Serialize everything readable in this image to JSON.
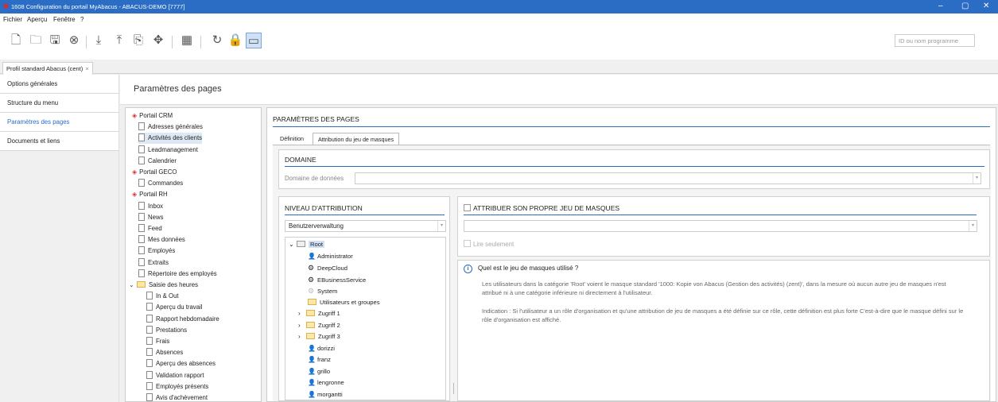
{
  "window": {
    "title": "1608 Configuration du portail MyAbacus - ABACUS-DEMO [7777]",
    "controls": [
      "–",
      "▢",
      "✕"
    ]
  },
  "menu": {
    "items": [
      "Fichier",
      "Aperçu",
      "Fenêtre",
      "?"
    ]
  },
  "toolbar": {
    "search_placeholder": "ID ou nom programme"
  },
  "doc_tab": {
    "label": "Profil standard Abacus (cent)",
    "close": "×"
  },
  "leftnav": {
    "items": [
      {
        "label": "Options générales",
        "selected": false
      },
      {
        "label": "Structure du menu",
        "selected": false
      },
      {
        "label": "Paramètres des pages",
        "selected": true
      },
      {
        "label": "Documents et liens",
        "selected": false
      }
    ]
  },
  "page": {
    "title": "Paramètres des pages"
  },
  "tree": {
    "rows": [
      {
        "label": "Portail CRM",
        "kind": "group",
        "level": 0
      },
      {
        "label": "Adresses générales",
        "kind": "page",
        "level": 1
      },
      {
        "label": "Activités des clients",
        "kind": "page",
        "level": 1,
        "selected": true
      },
      {
        "label": "Leadmanagement",
        "kind": "page",
        "level": 1
      },
      {
        "label": "Calendrier",
        "kind": "page",
        "level": 1
      },
      {
        "label": "Portail GECO",
        "kind": "group",
        "level": 0
      },
      {
        "label": "Commandes",
        "kind": "page",
        "level": 1
      },
      {
        "label": "Portail RH",
        "kind": "group",
        "level": 0
      },
      {
        "label": "Inbox",
        "kind": "page",
        "level": 1
      },
      {
        "label": "News",
        "kind": "page",
        "level": 1
      },
      {
        "label": "Feed",
        "kind": "page",
        "level": 1
      },
      {
        "label": "Mes données",
        "kind": "page",
        "level": 1
      },
      {
        "label": "Employés",
        "kind": "page",
        "level": 1
      },
      {
        "label": "Extraits",
        "kind": "page",
        "level": 1
      },
      {
        "label": "Répertoire des employés",
        "kind": "page",
        "level": 1
      },
      {
        "label": "Saisie des heures",
        "kind": "folder",
        "level": 1,
        "expanded": true
      },
      {
        "label": "In & Out",
        "kind": "page",
        "level": 2
      },
      {
        "label": "Aperçu du travail",
        "kind": "page",
        "level": 2
      },
      {
        "label": "Rapport hebdomadaire",
        "kind": "page",
        "level": 2
      },
      {
        "label": "Prestations",
        "kind": "page",
        "level": 2
      },
      {
        "label": "Frais",
        "kind": "page",
        "level": 2
      },
      {
        "label": "Absences",
        "kind": "page",
        "level": 2
      },
      {
        "label": "Aperçu des absences",
        "kind": "page",
        "level": 2
      },
      {
        "label": "Validation rapport",
        "kind": "page",
        "level": 2
      },
      {
        "label": "Employés présents",
        "kind": "page",
        "level": 2
      },
      {
        "label": "Avis d'achèvement",
        "kind": "page",
        "level": 2
      }
    ]
  },
  "main": {
    "section_title": "PARAMÈTRES DES PAGES",
    "tabs": [
      {
        "label": "Définition",
        "selected": false
      },
      {
        "label": "Attribution du jeu de masques",
        "selected": true
      }
    ],
    "domaine": {
      "title": "DOMAINE",
      "field_label": "Domaine de données",
      "value": ""
    },
    "niveau": {
      "title": "NIVEAU D'ATTRIBUTION",
      "select_value": "Benutzerverwaltung",
      "roles": [
        {
          "label": "Root",
          "kind": "folder",
          "level": 0,
          "expanded": true,
          "selected": true
        },
        {
          "label": "Administrator",
          "kind": "person",
          "level": 1
        },
        {
          "label": "DeepCloud",
          "kind": "gear",
          "level": 1
        },
        {
          "label": "EBusinessService",
          "kind": "gear",
          "level": 1
        },
        {
          "label": "System",
          "kind": "gear-light",
          "level": 1
        },
        {
          "label": "Utilisateurs et groupes",
          "kind": "folder",
          "level": 1
        },
        {
          "label": "Zugriff 1",
          "kind": "folder",
          "level": 1,
          "collapsed": true
        },
        {
          "label": "Zugriff 2",
          "kind": "folder",
          "level": 1,
          "collapsed": true
        },
        {
          "label": "Zugriff 3",
          "kind": "folder",
          "level": 1,
          "collapsed": true
        },
        {
          "label": "dorizzi",
          "kind": "person",
          "level": 1
        },
        {
          "label": "franz",
          "kind": "person",
          "level": 1
        },
        {
          "label": "grillo",
          "kind": "person",
          "level": 1
        },
        {
          "label": "lengronne",
          "kind": "person",
          "level": 1
        },
        {
          "label": "morgantti",
          "kind": "person",
          "level": 1
        }
      ]
    },
    "attribuer": {
      "title": "ATTRIBUER SON PROPRE JEU DE MASQUES",
      "checked": false,
      "field_value": "",
      "readonly_label": "Lire seulement"
    },
    "info": {
      "question": "Quel est le jeu de masques utilisé ?",
      "para1": "Les utilisateurs dans la catégorie 'Root' voient le masque standard '1000: Kopie von Abacus (Gestion des activités) (zent)', dans la mesure où aucun autre jeu de masques n'est attribué ni à une catégorie inférieure ni directement à l'utilisateur.",
      "para2": "Indication : Si l'utilisateur a un rôle d'organisation et qu'une attribution de jeu de masques a été définie sur ce rôle, cette définition est plus forte C'est-à-dire que le masque défini sur le rôle d'organisation est affiché."
    }
  },
  "colors": {
    "accent": "#2b6cc4",
    "titlebar": "#2b6cc4",
    "group_icon": "#dd3333"
  }
}
